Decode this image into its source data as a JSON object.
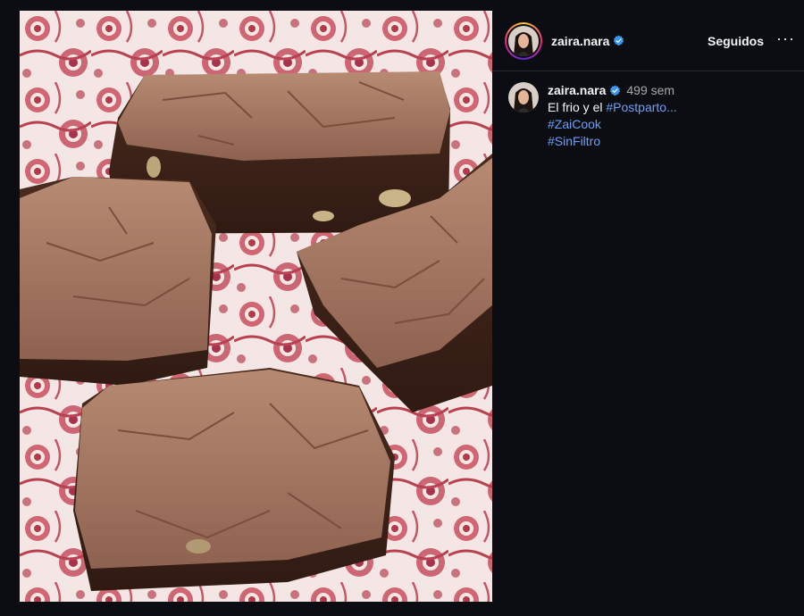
{
  "post": {
    "author": {
      "username": "zaira.nara",
      "verified": true
    },
    "follow_label": "Seguidos",
    "more_label": "···",
    "caption": {
      "username": "zaira.nara",
      "time": "499 sem",
      "text": "El frio y el ",
      "inline_tag": "#Postparto...",
      "tags": [
        "#ZaiCook",
        "#SinFiltro"
      ]
    },
    "image": {
      "subject": "brownies-on-floral-plate"
    }
  },
  "colors": {
    "background": "#0b0d12",
    "link": "#6d9ff7",
    "verified": "#3897f0",
    "muted": "#a8a8a8"
  }
}
